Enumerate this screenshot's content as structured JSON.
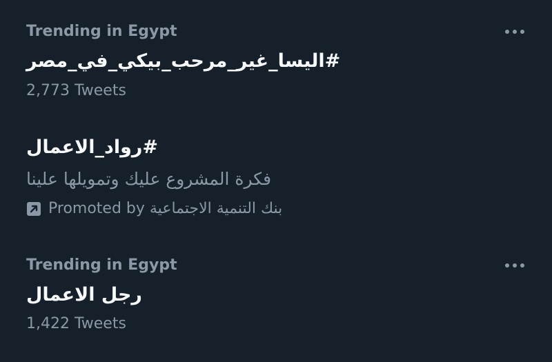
{
  "trends": [
    {
      "context": "Trending in Egypt",
      "title": "#اليسا_غير_مرحب_بيكي_في_مصر",
      "tweets": "2,773 Tweets",
      "more_icon": "more-horizontal-icon"
    },
    {
      "title": "#رواد_الاعمال",
      "description": "فكرة المشروع عليك وتمويلها علينا",
      "promoted_text": "Promoted by بنك التنمية الاجتماعية",
      "promoted_icon": "promoted-arrow-icon"
    },
    {
      "context": "Trending in Egypt",
      "title": "رجل الاعمال",
      "tweets": "1,422 Tweets",
      "more_icon": "more-horizontal-icon"
    }
  ],
  "colors": {
    "background": "#15202b",
    "primary_text": "#f7f9f9",
    "secondary_text": "#8b98a5"
  }
}
